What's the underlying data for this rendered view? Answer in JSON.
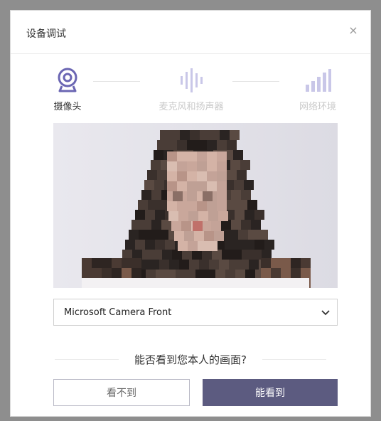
{
  "dialog": {
    "title": "设备调试",
    "close_symbol": "×"
  },
  "steps": [
    {
      "label": "摄像头",
      "icon": "webcam-icon",
      "state": "active"
    },
    {
      "label": "麦克风和扬声器",
      "icon": "sound-wave-icon",
      "state": "inactive"
    },
    {
      "label": "网络环境",
      "icon": "signal-bars-icon",
      "state": "inactive"
    }
  ],
  "colors": {
    "accent": "#6b66b3",
    "inactive": "#c9c7e8",
    "primary_button": "#5c5b80"
  },
  "camera_select": {
    "value": "Microsoft Camera Front"
  },
  "question": "能否看到您本人的画面?",
  "buttons": {
    "no": "看不到",
    "yes": "能看到"
  }
}
